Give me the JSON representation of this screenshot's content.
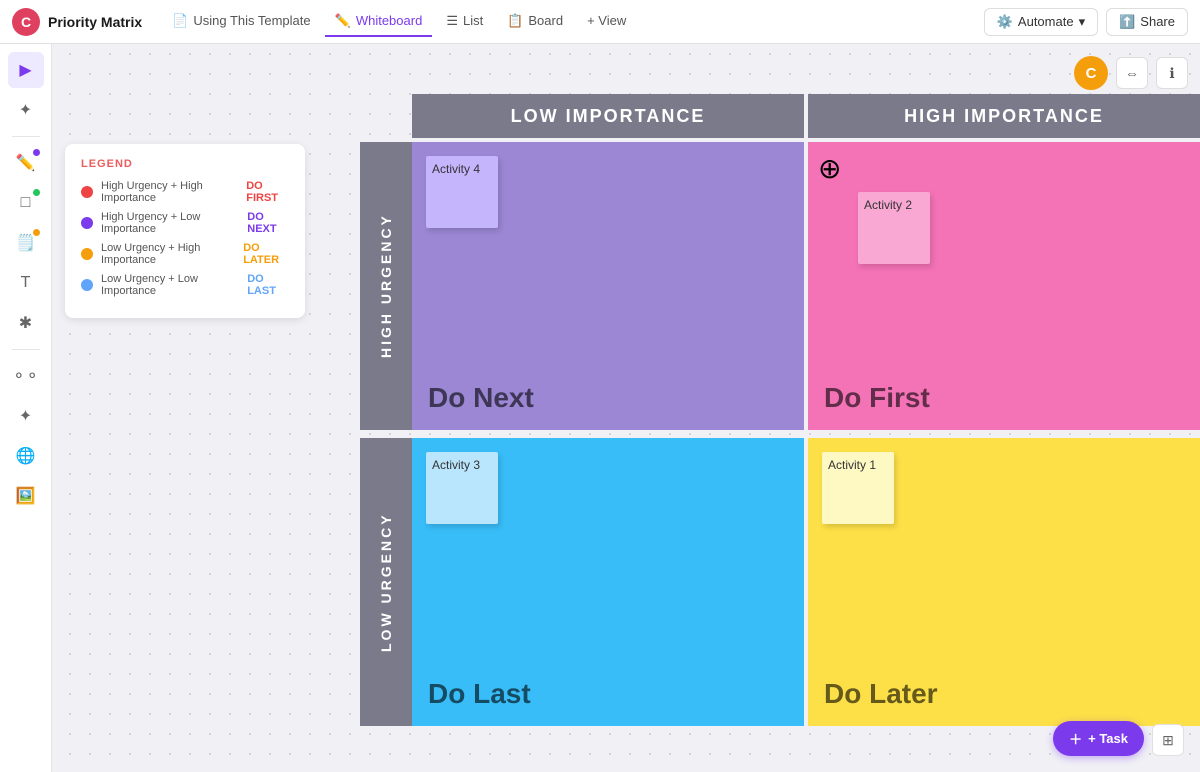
{
  "nav": {
    "logo_letter": "C",
    "app_name": "Priority Matrix",
    "tabs": [
      {
        "id": "template",
        "label": "Using This Template",
        "icon": "📄",
        "active": false
      },
      {
        "id": "whiteboard",
        "label": "Whiteboard",
        "icon": "✏️",
        "active": true
      },
      {
        "id": "list",
        "label": "List",
        "icon": "☰",
        "active": false
      },
      {
        "id": "board",
        "label": "Board",
        "icon": "📋",
        "active": false
      },
      {
        "id": "view",
        "label": "+ View",
        "icon": "",
        "active": false
      }
    ],
    "automate_label": "Automate",
    "share_label": "Share"
  },
  "canvas": {
    "avatar_letter": "C"
  },
  "legend": {
    "title": "LEGEND",
    "items": [
      {
        "color": "red",
        "text": "High Urgency + High Importance",
        "tag": "DO FIRST",
        "tag_class": "tag-first"
      },
      {
        "color": "purple",
        "text": "High Urgency + Low Importance",
        "tag": "DO NEXT",
        "tag_class": "tag-next"
      },
      {
        "color": "yellow",
        "text": "Low Urgency + High Importance",
        "tag": "DO LATER",
        "tag_class": "tag-later"
      },
      {
        "color": "blue",
        "text": "Low Urgency + Low Importance",
        "tag": "DO LAST",
        "tag_class": "tag-last"
      }
    ]
  },
  "matrix": {
    "col_low": "LOW IMPORTANCE",
    "col_high": "HIGH IMPORTANCE",
    "row_high": "HIGH URGENCY",
    "row_low": "LOW URGENCY",
    "cells": {
      "high_low_label": "Do Next",
      "high_high_label": "Do First",
      "low_low_label": "Do Last",
      "low_high_label": "Do Later"
    },
    "activities": {
      "activity1": "Activity 1",
      "activity2": "Activity 2",
      "activity3": "Activity 3",
      "activity4": "Activity 4"
    }
  },
  "toolbar": {
    "task_label": "+ Task"
  }
}
